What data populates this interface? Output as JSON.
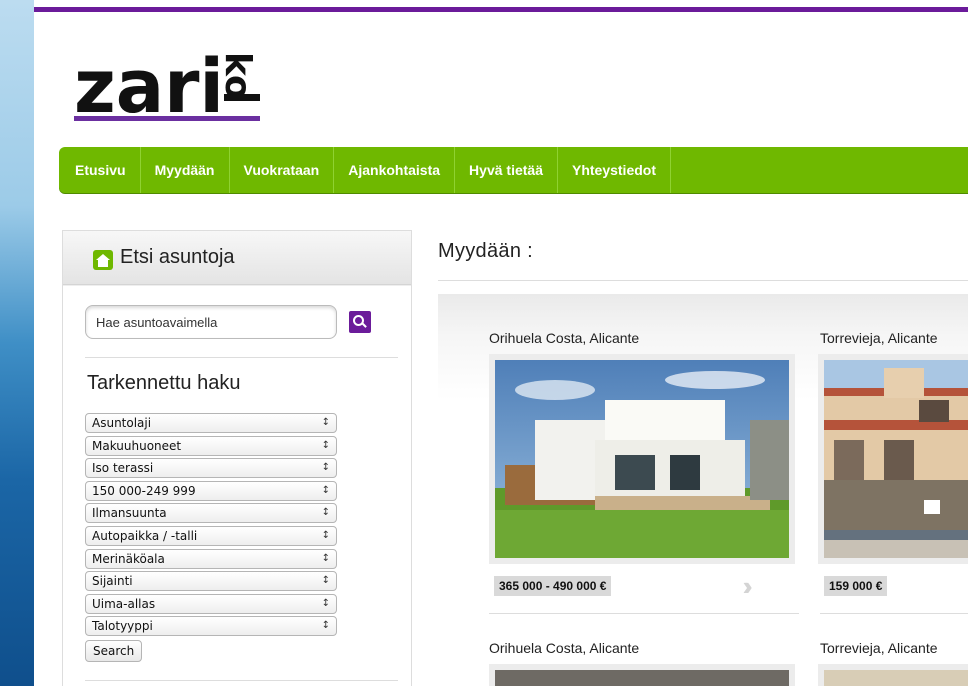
{
  "brand": {
    "logo_text": "zari",
    "logo_side_text": "ko",
    "colors": {
      "purple": "#6b1b9a",
      "green": "#6fb800"
    }
  },
  "nav": {
    "items": [
      {
        "label": "Etusivu"
      },
      {
        "label": "Myydään"
      },
      {
        "label": "Vuokrataan"
      },
      {
        "label": "Ajankohtaista"
      },
      {
        "label": "Hyvä tietää"
      },
      {
        "label": "Yhteystiedot"
      }
    ]
  },
  "sidebar": {
    "title": "Etsi asuntoja",
    "icon": "home-icon",
    "search": {
      "value": "Hae asuntoavaimella",
      "button_icon": "search-icon"
    },
    "refine_title": "Tarkennettu haku",
    "filters": [
      {
        "label": "Asuntolaji"
      },
      {
        "label": "Makuuhuoneet"
      },
      {
        "label": "Iso terassi"
      },
      {
        "label": "150 000-249 999"
      },
      {
        "label": "Ilmansuunta"
      },
      {
        "label": "Autopaikka / -talli"
      },
      {
        "label": "Merinäköala"
      },
      {
        "label": "Sijainti"
      },
      {
        "label": "Uima-allas"
      },
      {
        "label": "Talotyyppi"
      }
    ],
    "submit_label": "Search"
  },
  "main": {
    "title": "Myydään :",
    "listings": [
      {
        "location": "Orihuela Costa, Alicante",
        "price": "365 000 - 490 000 €",
        "next_icon": "double-chevron-right-icon"
      },
      {
        "location": "Torrevieja, Alicante",
        "price": "159 000 €"
      },
      {
        "location": "Orihuela Costa, Alicante"
      },
      {
        "location": "Torrevieja, Alicante"
      }
    ]
  }
}
